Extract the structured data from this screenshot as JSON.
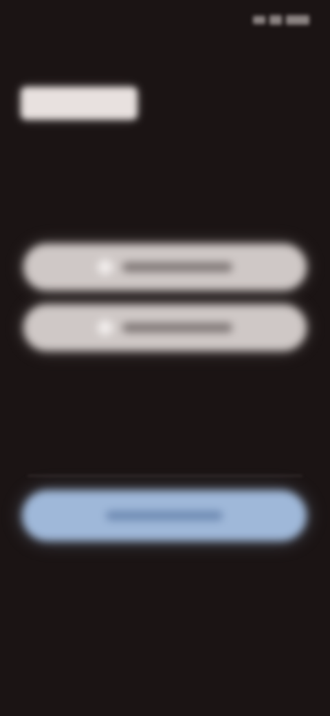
{
  "status_bar": {
    "time": "",
    "icons": [
      "signal-icon",
      "wifi-icon",
      "battery-icon"
    ]
  },
  "logo": {
    "text": ""
  },
  "sign_in": {
    "google_label": "",
    "apple_label": "",
    "divider_text": ""
  },
  "form": {
    "input_label": "",
    "continue_label": ""
  },
  "footer": {
    "terms_text": "",
    "link_primary": "",
    "link_secondary": ""
  },
  "colors": {
    "background": "#1b1414",
    "button_light": "#cfc8c6",
    "button_accent": "#9fb8d9"
  }
}
